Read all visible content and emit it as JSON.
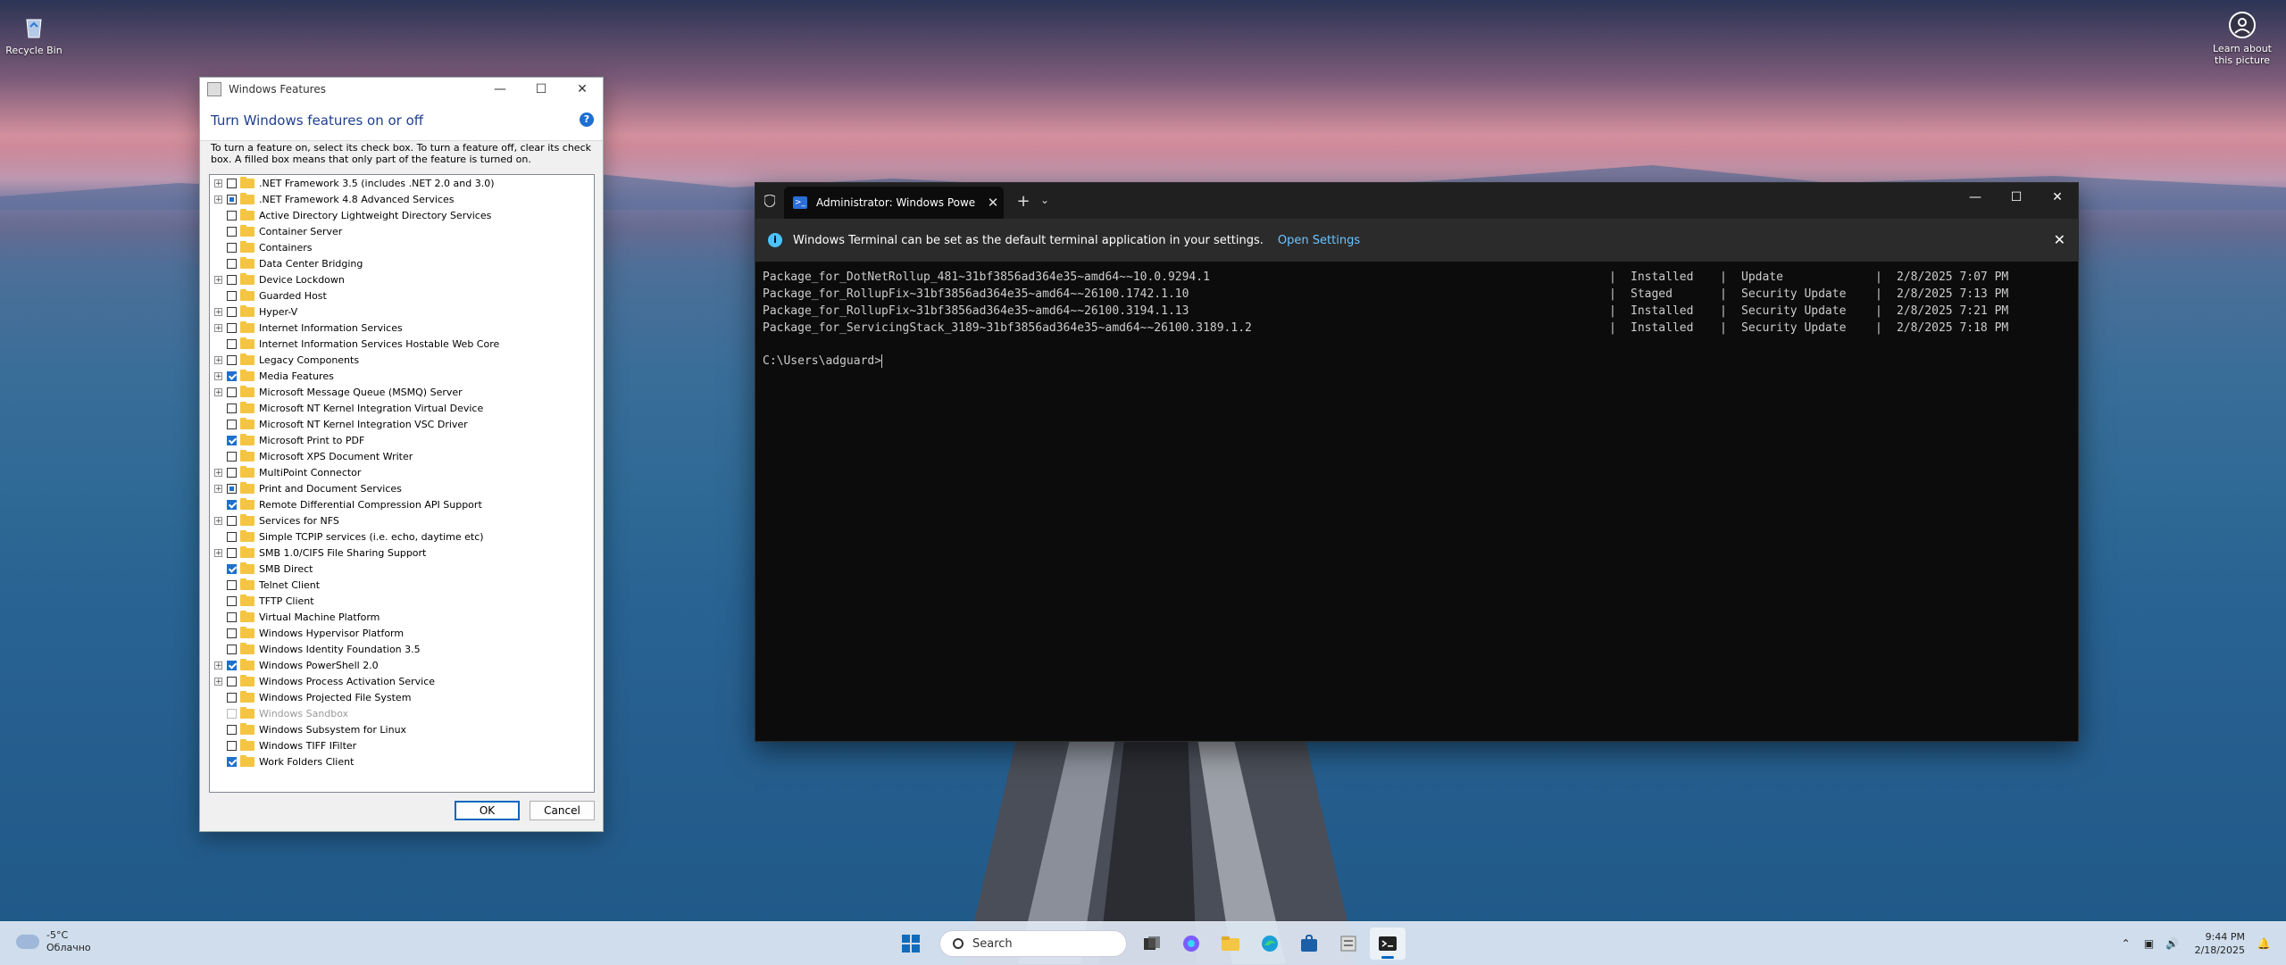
{
  "desktop": {
    "recycle_bin": "Recycle Bin",
    "learn_about_line1": "Learn about",
    "learn_about_line2": "this picture"
  },
  "features_dialog": {
    "title": "Windows Features",
    "heading": "Turn Windows features on or off",
    "description": "To turn a feature on, select its check box. To turn a feature off, clear its check box. A filled box means that only part of the feature is turned on.",
    "ok": "OK",
    "cancel": "Cancel",
    "features": [
      {
        "label": ".NET Framework 3.5 (includes .NET 2.0 and 3.0)",
        "expandable": true,
        "state": "unchecked"
      },
      {
        "label": ".NET Framework 4.8 Advanced Services",
        "expandable": true,
        "state": "partial"
      },
      {
        "label": "Active Directory Lightweight Directory Services",
        "expandable": false,
        "state": "unchecked"
      },
      {
        "label": "Container Server",
        "expandable": false,
        "state": "unchecked"
      },
      {
        "label": "Containers",
        "expandable": false,
        "state": "unchecked"
      },
      {
        "label": "Data Center Bridging",
        "expandable": false,
        "state": "unchecked"
      },
      {
        "label": "Device Lockdown",
        "expandable": true,
        "state": "unchecked"
      },
      {
        "label": "Guarded Host",
        "expandable": false,
        "state": "unchecked"
      },
      {
        "label": "Hyper-V",
        "expandable": true,
        "state": "unchecked"
      },
      {
        "label": "Internet Information Services",
        "expandable": true,
        "state": "unchecked"
      },
      {
        "label": "Internet Information Services Hostable Web Core",
        "expandable": false,
        "state": "unchecked"
      },
      {
        "label": "Legacy Components",
        "expandable": true,
        "state": "unchecked"
      },
      {
        "label": "Media Features",
        "expandable": true,
        "state": "checked"
      },
      {
        "label": "Microsoft Message Queue (MSMQ) Server",
        "expandable": true,
        "state": "unchecked"
      },
      {
        "label": "Microsoft NT Kernel Integration Virtual Device",
        "expandable": false,
        "state": "unchecked"
      },
      {
        "label": "Microsoft NT Kernel Integration VSC Driver",
        "expandable": false,
        "state": "unchecked"
      },
      {
        "label": "Microsoft Print to PDF",
        "expandable": false,
        "state": "checked"
      },
      {
        "label": "Microsoft XPS Document Writer",
        "expandable": false,
        "state": "unchecked"
      },
      {
        "label": "MultiPoint Connector",
        "expandable": true,
        "state": "unchecked"
      },
      {
        "label": "Print and Document Services",
        "expandable": true,
        "state": "partial"
      },
      {
        "label": "Remote Differential Compression API Support",
        "expandable": false,
        "state": "checked"
      },
      {
        "label": "Services for NFS",
        "expandable": true,
        "state": "unchecked"
      },
      {
        "label": "Simple TCPIP services (i.e. echo, daytime etc)",
        "expandable": false,
        "state": "unchecked"
      },
      {
        "label": "SMB 1.0/CIFS File Sharing Support",
        "expandable": true,
        "state": "unchecked"
      },
      {
        "label": "SMB Direct",
        "expandable": false,
        "state": "checked"
      },
      {
        "label": "Telnet Client",
        "expandable": false,
        "state": "unchecked"
      },
      {
        "label": "TFTP Client",
        "expandable": false,
        "state": "unchecked"
      },
      {
        "label": "Virtual Machine Platform",
        "expandable": false,
        "state": "unchecked"
      },
      {
        "label": "Windows Hypervisor Platform",
        "expandable": false,
        "state": "unchecked"
      },
      {
        "label": "Windows Identity Foundation 3.5",
        "expandable": false,
        "state": "unchecked"
      },
      {
        "label": "Windows PowerShell 2.0",
        "expandable": true,
        "state": "checked"
      },
      {
        "label": "Windows Process Activation Service",
        "expandable": true,
        "state": "unchecked"
      },
      {
        "label": "Windows Projected File System",
        "expandable": false,
        "state": "unchecked"
      },
      {
        "label": "Windows Sandbox",
        "expandable": false,
        "state": "disabled"
      },
      {
        "label": "Windows Subsystem for Linux",
        "expandable": false,
        "state": "unchecked"
      },
      {
        "label": "Windows TIFF IFilter",
        "expandable": false,
        "state": "unchecked"
      },
      {
        "label": "Work Folders Client",
        "expandable": false,
        "state": "checked"
      }
    ]
  },
  "terminal": {
    "tab_title": "Administrator: Windows Powe",
    "info_text": "Windows Terminal can be set as the default terminal application in your settings.",
    "open_settings": "Open Settings",
    "packages": [
      {
        "name": "Package_for_DotNetRollup_481~31bf3856ad364e35~amd64~~10.0.9294.1",
        "state": "Installed",
        "type": "Update",
        "date": "2/8/2025 7:07 PM"
      },
      {
        "name": "Package_for_RollupFix~31bf3856ad364e35~amd64~~26100.1742.1.10",
        "state": "Staged",
        "type": "Security Update",
        "date": "2/8/2025 7:13 PM"
      },
      {
        "name": "Package_for_RollupFix~31bf3856ad364e35~amd64~~26100.3194.1.13",
        "state": "Installed",
        "type": "Security Update",
        "date": "2/8/2025 7:21 PM"
      },
      {
        "name": "Package_for_ServicingStack_3189~31bf3856ad364e35~amd64~~26100.3189.1.2",
        "state": "Installed",
        "type": "Security Update",
        "date": "2/8/2025 7:18 PM"
      }
    ],
    "separator": "|",
    "prompt": "C:\\Users\\adguard>"
  },
  "taskbar": {
    "weather_temp": "-5°C",
    "weather_desc": "Облачно",
    "search_label": "Search",
    "time": "9:44 PM",
    "date": "2/18/2025"
  },
  "colors": {
    "accent": "#0067c0",
    "folder": "#f4c542",
    "terminal_bg": "#0c0c0c",
    "link": "#6cc4ff"
  }
}
